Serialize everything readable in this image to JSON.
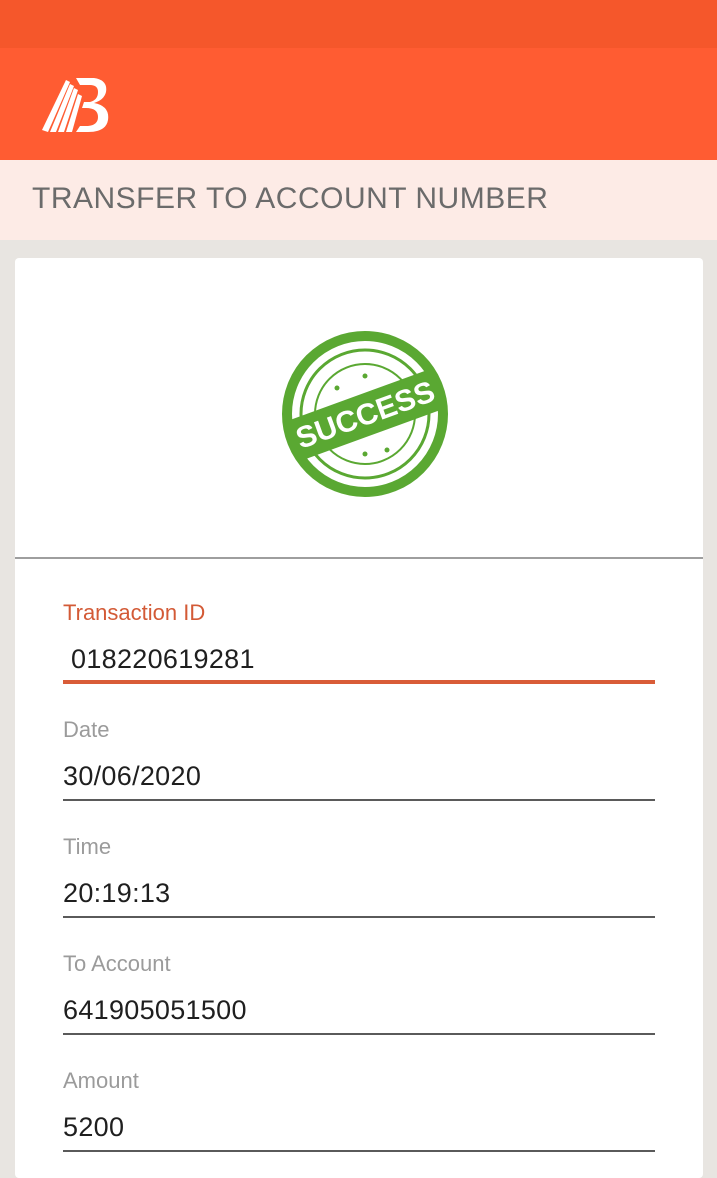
{
  "header": {
    "brand_color": "#ff5c32",
    "status_bar_color": "#f5572b",
    "logo_icon": "bank-of-baroda-logo"
  },
  "page": {
    "title": "TRANSFER TO ACCOUNT NUMBER"
  },
  "status": {
    "stamp_text": "SUCCESS",
    "stamp_color": "#5aa832"
  },
  "fields": [
    {
      "label": "Transaction ID",
      "value": "018220619281",
      "focused": true
    },
    {
      "label": "Date",
      "value": "30/06/2020"
    },
    {
      "label": "Time",
      "value": "20:19:13"
    },
    {
      "label": "To Account",
      "value": "641905051500"
    },
    {
      "label": "Amount",
      "value": "5200"
    }
  ]
}
